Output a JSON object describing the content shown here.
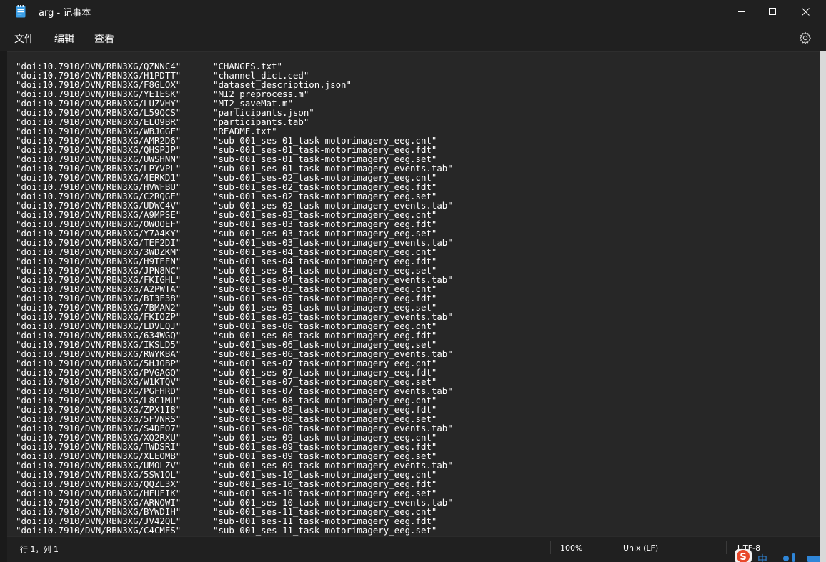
{
  "window": {
    "title": "arg - 记事本"
  },
  "menu": {
    "file": "文件",
    "edit": "编辑",
    "view": "查看"
  },
  "editor": {
    "content": "\"doi:10.7910/DVN/RBN3XG/QZNNC4\"      \"CHANGES.txt\"\n\"doi:10.7910/DVN/RBN3XG/H1PDTT\"      \"channel_dict.ced\"\n\"doi:10.7910/DVN/RBN3XG/F8GLOX\"      \"dataset_description.json\"\n\"doi:10.7910/DVN/RBN3XG/YE1ESK\"      \"MI2_preprocess.m\"\n\"doi:10.7910/DVN/RBN3XG/LUZVHY\"      \"MI2_saveMat.m\"\n\"doi:10.7910/DVN/RBN3XG/L59QCS\"      \"participants.json\"\n\"doi:10.7910/DVN/RBN3XG/ELO9BR\"      \"participants.tab\"\n\"doi:10.7910/DVN/RBN3XG/WBJGGF\"      \"README.txt\"\n\"doi:10.7910/DVN/RBN3XG/AMR2D6\"      \"sub-001_ses-01_task-motorimagery_eeg.cnt\"\n\"doi:10.7910/DVN/RBN3XG/QHSPJP\"      \"sub-001_ses-01_task-motorimagery_eeg.fdt\"\n\"doi:10.7910/DVN/RBN3XG/UWSHNN\"      \"sub-001_ses-01_task-motorimagery_eeg.set\"\n\"doi:10.7910/DVN/RBN3XG/LPYVPL\"      \"sub-001_ses-01_task-motorimagery_events.tab\"\n\"doi:10.7910/DVN/RBN3XG/4ERKD1\"      \"sub-001_ses-02_task-motorimagery_eeg.cnt\"\n\"doi:10.7910/DVN/RBN3XG/HVWFBU\"      \"sub-001_ses-02_task-motorimagery_eeg.fdt\"\n\"doi:10.7910/DVN/RBN3XG/C2RQGE\"      \"sub-001_ses-02_task-motorimagery_eeg.set\"\n\"doi:10.7910/DVN/RBN3XG/UDWC4V\"      \"sub-001_ses-02_task-motorimagery_events.tab\"\n\"doi:10.7910/DVN/RBN3XG/A9MPSE\"      \"sub-001_ses-03_task-motorimagery_eeg.cnt\"\n\"doi:10.7910/DVN/RBN3XG/OWOOEF\"      \"sub-001_ses-03_task-motorimagery_eeg.fdt\"\n\"doi:10.7910/DVN/RBN3XG/Y7A4KY\"      \"sub-001_ses-03_task-motorimagery_eeg.set\"\n\"doi:10.7910/DVN/RBN3XG/TEF2DI\"      \"sub-001_ses-03_task-motorimagery_events.tab\"\n\"doi:10.7910/DVN/RBN3XG/3WDZKM\"      \"sub-001_ses-04_task-motorimagery_eeg.cnt\"\n\"doi:10.7910/DVN/RBN3XG/H9TEEN\"      \"sub-001_ses-04_task-motorimagery_eeg.fdt\"\n\"doi:10.7910/DVN/RBN3XG/JPN8NC\"      \"sub-001_ses-04_task-motorimagery_eeg.set\"\n\"doi:10.7910/DVN/RBN3XG/FKIGHL\"      \"sub-001_ses-04_task-motorimagery_events.tab\"\n\"doi:10.7910/DVN/RBN3XG/A2PWTA\"      \"sub-001_ses-05_task-motorimagery_eeg.cnt\"\n\"doi:10.7910/DVN/RBN3XG/BI3E38\"      \"sub-001_ses-05_task-motorimagery_eeg.fdt\"\n\"doi:10.7910/DVN/RBN3XG/7BMAN2\"      \"sub-001_ses-05_task-motorimagery_eeg.set\"\n\"doi:10.7910/DVN/RBN3XG/FKIOZP\"      \"sub-001_ses-05_task-motorimagery_events.tab\"\n\"doi:10.7910/DVN/RBN3XG/LDVLQJ\"      \"sub-001_ses-06_task-motorimagery_eeg.cnt\"\n\"doi:10.7910/DVN/RBN3XG/634WGQ\"      \"sub-001_ses-06_task-motorimagery_eeg.fdt\"\n\"doi:10.7910/DVN/RBN3XG/IKSLD5\"      \"sub-001_ses-06_task-motorimagery_eeg.set\"\n\"doi:10.7910/DVN/RBN3XG/RWYKBA\"      \"sub-001_ses-06_task-motorimagery_events.tab\"\n\"doi:10.7910/DVN/RBN3XG/5HJOBP\"      \"sub-001_ses-07_task-motorimagery_eeg.cnt\"\n\"doi:10.7910/DVN/RBN3XG/PVGAGQ\"      \"sub-001_ses-07_task-motorimagery_eeg.fdt\"\n\"doi:10.7910/DVN/RBN3XG/W1KTQV\"      \"sub-001_ses-07_task-motorimagery_eeg.set\"\n\"doi:10.7910/DVN/RBN3XG/PGFHRD\"      \"sub-001_ses-07_task-motorimagery_events.tab\"\n\"doi:10.7910/DVN/RBN3XG/L8C1MU\"      \"sub-001_ses-08_task-motorimagery_eeg.cnt\"\n\"doi:10.7910/DVN/RBN3XG/ZPX1I8\"      \"sub-001_ses-08_task-motorimagery_eeg.fdt\"\n\"doi:10.7910/DVN/RBN3XG/5FVNRS\"      \"sub-001_ses-08_task-motorimagery_eeg.set\"\n\"doi:10.7910/DVN/RBN3XG/S4DFO7\"      \"sub-001_ses-08_task-motorimagery_events.tab\"\n\"doi:10.7910/DVN/RBN3XG/XQ2RXU\"      \"sub-001_ses-09_task-motorimagery_eeg.cnt\"\n\"doi:10.7910/DVN/RBN3XG/TWDSRI\"      \"sub-001_ses-09_task-motorimagery_eeg.fdt\"\n\"doi:10.7910/DVN/RBN3XG/XLEOMB\"      \"sub-001_ses-09_task-motorimagery_eeg.set\"\n\"doi:10.7910/DVN/RBN3XG/UMOLZV\"      \"sub-001_ses-09_task-motorimagery_events.tab\"\n\"doi:10.7910/DVN/RBN3XG/5SW1OL\"      \"sub-001_ses-10_task-motorimagery_eeg.cnt\"\n\"doi:10.7910/DVN/RBN3XG/QQZL3X\"      \"sub-001_ses-10_task-motorimagery_eeg.fdt\"\n\"doi:10.7910/DVN/RBN3XG/HFUFIK\"      \"sub-001_ses-10_task-motorimagery_eeg.set\"\n\"doi:10.7910/DVN/RBN3XG/ARNOWI\"      \"sub-001_ses-10_task-motorimagery_events.tab\"\n\"doi:10.7910/DVN/RBN3XG/BYWDIH\"      \"sub-001_ses-11_task-motorimagery_eeg.cnt\"\n\"doi:10.7910/DVN/RBN3XG/JV42QL\"      \"sub-001_ses-11_task-motorimagery_eeg.fdt\"\n\"doi:10.7910/DVN/RBN3XG/C4CMES\"      \"sub-001_ses-11_task-motorimagery_eeg.set\""
  },
  "status": {
    "position": "行 1，列 1",
    "zoom": "100%",
    "line_ending": "Unix (LF)",
    "encoding": "UTF-8"
  },
  "ime": {
    "lang": "中"
  },
  "colors": {
    "background": "#202020",
    "editor_bg": "#272727",
    "text": "#ffffff",
    "notepad_icon": "#3b9ee6"
  },
  "icons": {
    "app": "notepad-icon",
    "minimize": "minimize-icon",
    "maximize": "maximize-icon",
    "close": "close-icon",
    "settings": "gear-icon"
  }
}
